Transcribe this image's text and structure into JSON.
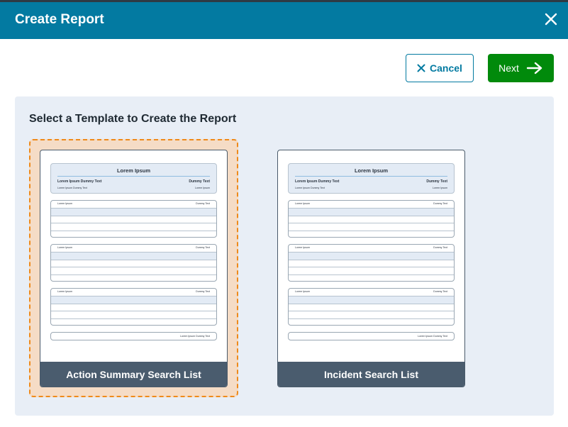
{
  "dialog": {
    "title": "Create Report",
    "close_icon": "close-icon"
  },
  "toolbar": {
    "cancel_label": "Cancel",
    "next_label": "Next"
  },
  "panel": {
    "heading": "Select a Template to Create the Report"
  },
  "templates": [
    {
      "name": "Action Summary Search List",
      "selected": true,
      "preview": {
        "title": "Lorem Ipsum",
        "subtitle_left": "Lorem Ipsum Dummy Text",
        "subtitle_right": "Dummy Text",
        "meta_left": "Lorem Ipsum Dummy Text",
        "meta_right": "Lorem Ipsum",
        "tables": [
          {
            "left": "Lorem Ipsum",
            "right": "Dummy Text"
          },
          {
            "left": "Lorem Ipsum",
            "right": "Dummy Text"
          },
          {
            "left": "Lorem Ipsum",
            "right": "Dummy Text"
          }
        ],
        "footer": "Lorem Ipsum Dummy Text"
      }
    },
    {
      "name": "Incident Search List",
      "selected": false,
      "preview": {
        "title": "Lorem Ipsum",
        "subtitle_left": "Lorem Ipsum Dummy Text",
        "subtitle_right": "Dummy Text",
        "meta_left": "Lorem Ipsum Dummy Text",
        "meta_right": "Lorem Ipsum",
        "tables": [
          {
            "left": "Lorem Ipsum",
            "right": "Dummy Text"
          },
          {
            "left": "Lorem Ipsum",
            "right": "Dummy Text"
          },
          {
            "left": "Lorem Ipsum",
            "right": "Dummy Text"
          }
        ],
        "footer": "Lorem Ipsum Dummy Text"
      }
    }
  ],
  "colors": {
    "titlebar": "#037aa1",
    "next_button": "#018a0b",
    "selected_border": "#ef8a1a",
    "selected_fill": "#f5dcc6",
    "card_label": "#4a5c6e"
  }
}
